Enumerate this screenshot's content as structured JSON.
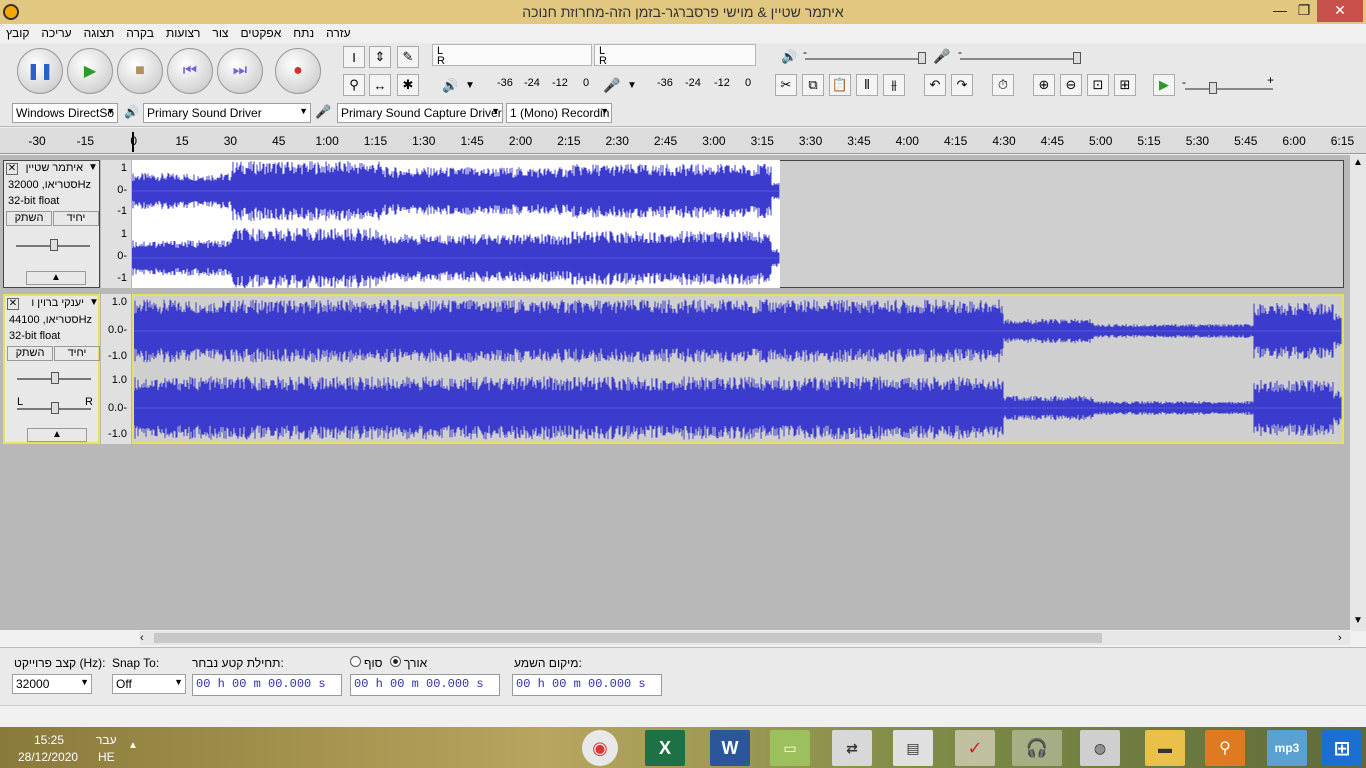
{
  "window": {
    "title": "איתמר שטיין & מוישי פרסברגר-בזמן הזה-מחרוזת חנוכה"
  },
  "menu": [
    "עזרה",
    "נתח",
    "אפקטים",
    "צור",
    "רצועות",
    "בקרה",
    "תצוגה",
    "עריכה",
    "קובץ"
  ],
  "transport": {
    "pause": "❚❚",
    "play": "▶",
    "stop": "■",
    "skip_start": "⏮",
    "skip_end": "⏭",
    "record": "●"
  },
  "meter": {
    "L": "L",
    "R": "R",
    "scale": [
      "-36",
      "-24",
      "-12",
      "0"
    ]
  },
  "mixer": {
    "minus": "-",
    "plus": "+"
  },
  "devices": {
    "host": "Windows DirectSo",
    "playback": "Primary Sound Driver",
    "recording": "Primary Sound Capture Driver",
    "channels": "1 (Mono) Recordin"
  },
  "ruler": {
    "labels": [
      "-30",
      "-15",
      "0",
      "15",
      "30",
      "45",
      "1:00",
      "1:15",
      "1:30",
      "1:45",
      "2:00",
      "2:15",
      "2:30",
      "2:45",
      "3:00",
      "3:15",
      "3:30",
      "3:45",
      "4:00",
      "4:15",
      "4:30",
      "4:45",
      "5:00",
      "5:15",
      "5:30",
      "5:45",
      "6:00",
      "6:15"
    ]
  },
  "tracks": [
    {
      "name": "איתמר שטיין",
      "info": "סטריאו, 32000Hz",
      "format": "32-bit float",
      "mute": "השתק",
      "solo": "יחיד",
      "scale": [
        "1",
        "0-",
        "-1"
      ],
      "scale2": [
        "1",
        "0-",
        "-1"
      ]
    },
    {
      "name": "יענקי ברוין ו",
      "info": "סטריאו, 44100Hz",
      "format": "32-bit float",
      "mute": "השתק",
      "solo": "יחיד",
      "scale": [
        "1.0",
        "0.0-",
        "-1.0"
      ],
      "scale2": [
        "1.0",
        "0.0-",
        "-1.0"
      ],
      "pan_L": "L",
      "pan_R": "R"
    }
  ],
  "bottom": {
    "rate_label": "קצב פרוייקט (Hz):",
    "rate_value": "32000",
    "snap_label": "Snap To:",
    "snap_value": "Off",
    "sel_start_label": "תחילת קטע נבחר:",
    "end_label": "סוף",
    "length_label": "אורך",
    "audio_pos_label": "מיקום השמע:",
    "time1": "00 h 00 m 00.000 s",
    "time2": "00 h 00 m 00.000 s",
    "time3": "00 h 00 m 00.000 s"
  },
  "taskbar": {
    "time": "15:25",
    "date": "28/12/2020",
    "lang": "עבר",
    "lang2": "HE"
  },
  "colors": {
    "wave": "#3b3bcd",
    "titlebar": "#e1c77f",
    "clip": "#cfcfcf"
  }
}
